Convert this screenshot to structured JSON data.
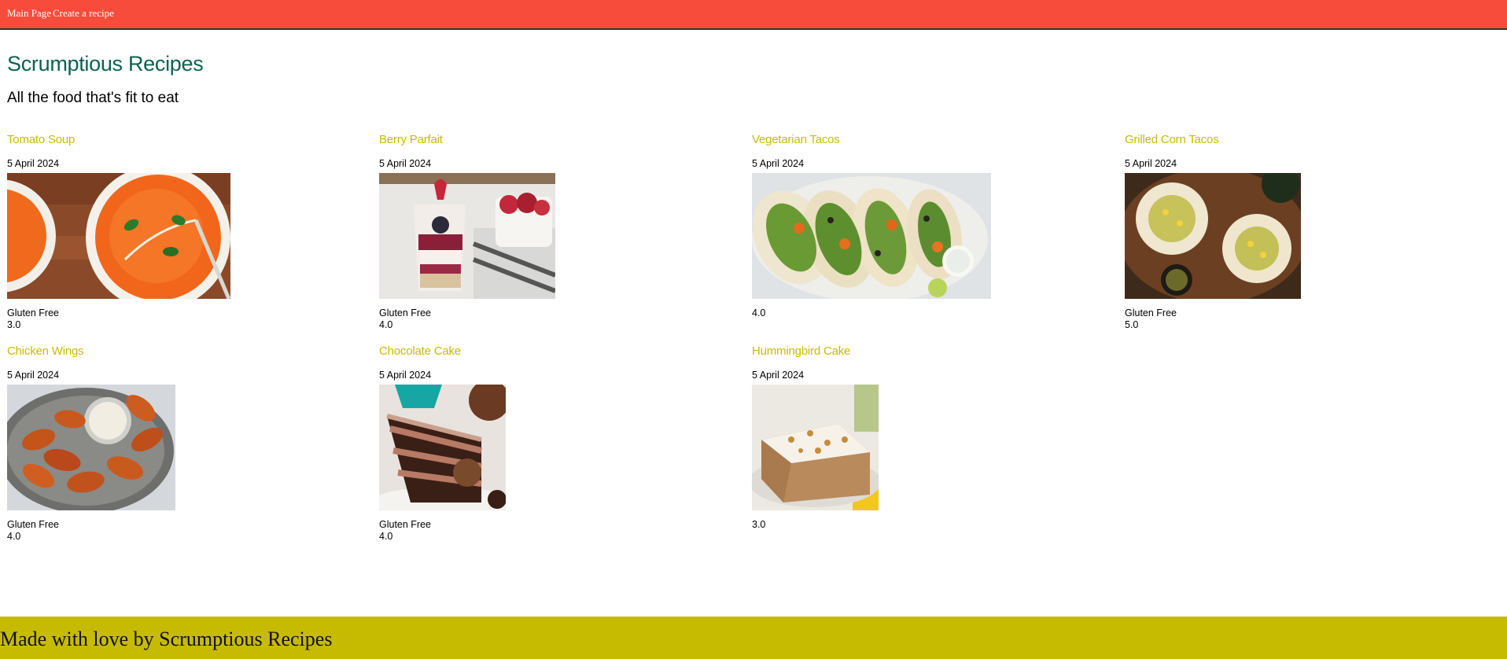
{
  "nav": {
    "main_label": "Main Page",
    "create_label": "Create a recipe"
  },
  "header": {
    "title": "Scrumptious Recipes",
    "subtitle": "All the food that's fit to eat"
  },
  "recipes": [
    {
      "title": "Tomato Soup",
      "date": "5 April 2024",
      "badge": "Gluten Free",
      "rating": "3.0"
    },
    {
      "title": "Berry Parfait",
      "date": "5 April 2024",
      "badge": "Gluten Free",
      "rating": "4.0"
    },
    {
      "title": "Vegetarian Tacos",
      "date": "5 April 2024",
      "badge": "",
      "rating": "4.0"
    },
    {
      "title": "Grilled Corn Tacos",
      "date": "5 April 2024",
      "badge": "Gluten Free",
      "rating": "5.0"
    },
    {
      "title": "Chicken Wings",
      "date": "5 April 2024",
      "badge": "Gluten Free",
      "rating": "4.0"
    },
    {
      "title": "Chocolate Cake",
      "date": "5 April 2024",
      "badge": "Gluten Free",
      "rating": "4.0"
    },
    {
      "title": "Hummingbird Cake",
      "date": "5 April 2024",
      "badge": "",
      "rating": "3.0"
    }
  ],
  "footer": {
    "text": "Made with love by Scrumptious Recipes"
  },
  "colors": {
    "nav_bg": "#f74c3c",
    "title": "#0d6152",
    "recipe_link": "#c9bb00",
    "footer_bg": "#c6bb00"
  }
}
